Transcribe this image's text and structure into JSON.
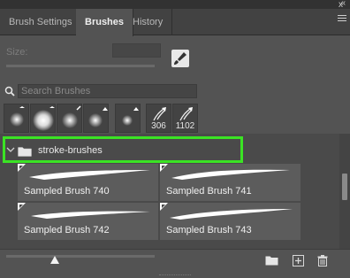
{
  "tabs": [
    {
      "label": "Brush Settings",
      "active": false
    },
    {
      "label": "Brushes",
      "active": true
    },
    {
      "label": "History",
      "active": false
    }
  ],
  "collapse_glyph": "«",
  "close_glyph": "x",
  "size": {
    "label": "Size:",
    "value": ""
  },
  "search": {
    "placeholder": "Search Brushes",
    "value": ""
  },
  "recent_brushes": [
    {
      "kind": "soft-small",
      "count": ""
    },
    {
      "kind": "soft-large",
      "count": ""
    },
    {
      "kind": "soft-medium",
      "count": ""
    },
    {
      "kind": "hard-medium",
      "count": ""
    },
    {
      "kind": "soft-small-2",
      "count": ""
    },
    {
      "kind": "sampled",
      "count": "306"
    },
    {
      "kind": "sampled",
      "count": "1102"
    }
  ],
  "group": {
    "name": "stroke-brushes",
    "expanded": true,
    "highlight_color": "#3be324"
  },
  "brushes": [
    {
      "label": "Sampled Brush 740"
    },
    {
      "label": "Sampled Brush 741"
    },
    {
      "label": "Sampled Brush 742"
    },
    {
      "label": "Sampled Brush 743"
    }
  ],
  "colors": {
    "panel": "#535353",
    "tabbar": "#424242",
    "list": "#4a4a4a",
    "tile": "#5c5c5c",
    "highlight": "#3be324"
  }
}
